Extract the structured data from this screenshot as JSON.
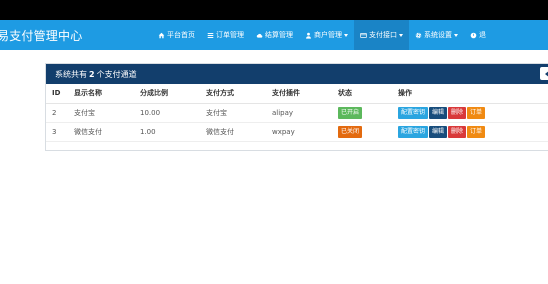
{
  "brand": {
    "title": "易支付管理中心"
  },
  "nav": {
    "items": [
      {
        "label": "平台首页",
        "icon": "home-icon"
      },
      {
        "label": "订单管理",
        "icon": "list-icon"
      },
      {
        "label": "结算管理",
        "icon": "cloud-icon"
      },
      {
        "label": "商户管理",
        "icon": "user-icon",
        "dropdown": true
      },
      {
        "label": "支付接口",
        "icon": "card-icon",
        "dropdown": true,
        "active": true
      },
      {
        "label": "系统设置",
        "icon": "gear-icon",
        "dropdown": true
      },
      {
        "label": "退",
        "icon": "logout-icon"
      }
    ]
  },
  "panel": {
    "prefix": "系统共有",
    "count": "2",
    "suffix": "个支付通道"
  },
  "table": {
    "headers": [
      "ID",
      "显示名称",
      "分成比例",
      "支付方式",
      "支付插件",
      "状态",
      "操作"
    ],
    "rows": [
      {
        "id": "2",
        "name": "支付宝",
        "rate": "10.00",
        "method": "支付宝",
        "plugin": "alipay",
        "status": "已开启",
        "status_color": "#5cb85c"
      },
      {
        "id": "3",
        "name": "微信支付",
        "rate": "1.00",
        "method": "微信支付",
        "plugin": "wxpay",
        "status": "已关闭",
        "status_color": "#e36a0f"
      }
    ],
    "actions": {
      "config": "配置密钥",
      "edit": "编辑",
      "delete": "删除",
      "order": "订单"
    }
  },
  "colors": {
    "navbar": "#1e9be3",
    "panel_head": "#123e6c"
  }
}
